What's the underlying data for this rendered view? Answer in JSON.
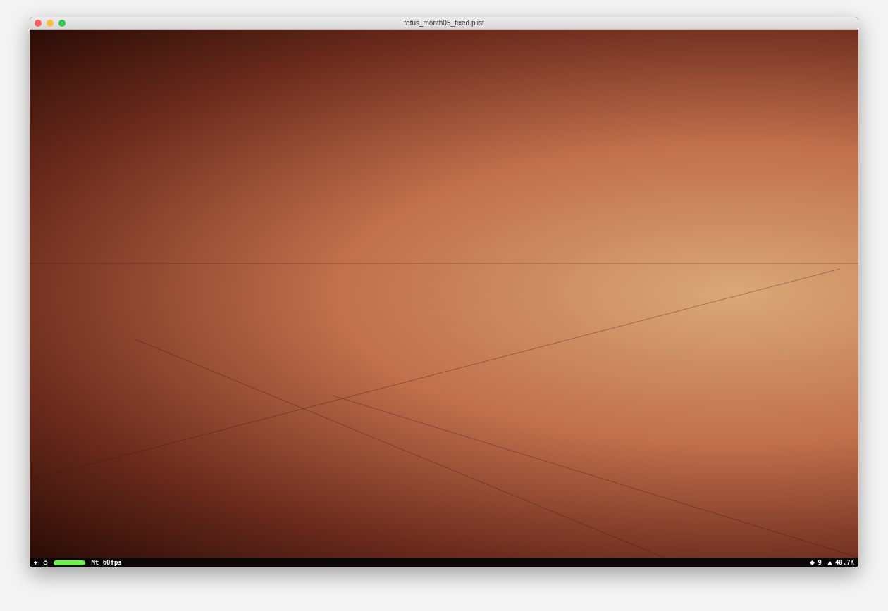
{
  "window": {
    "title": "fetus_month05_fixed.plist"
  },
  "status_bar": {
    "add": "+",
    "frame_meter": {
      "level": 1
    },
    "frame_rate": "Mt 60fps",
    "node_count": "9",
    "polygon_count": "48.7K"
  }
}
